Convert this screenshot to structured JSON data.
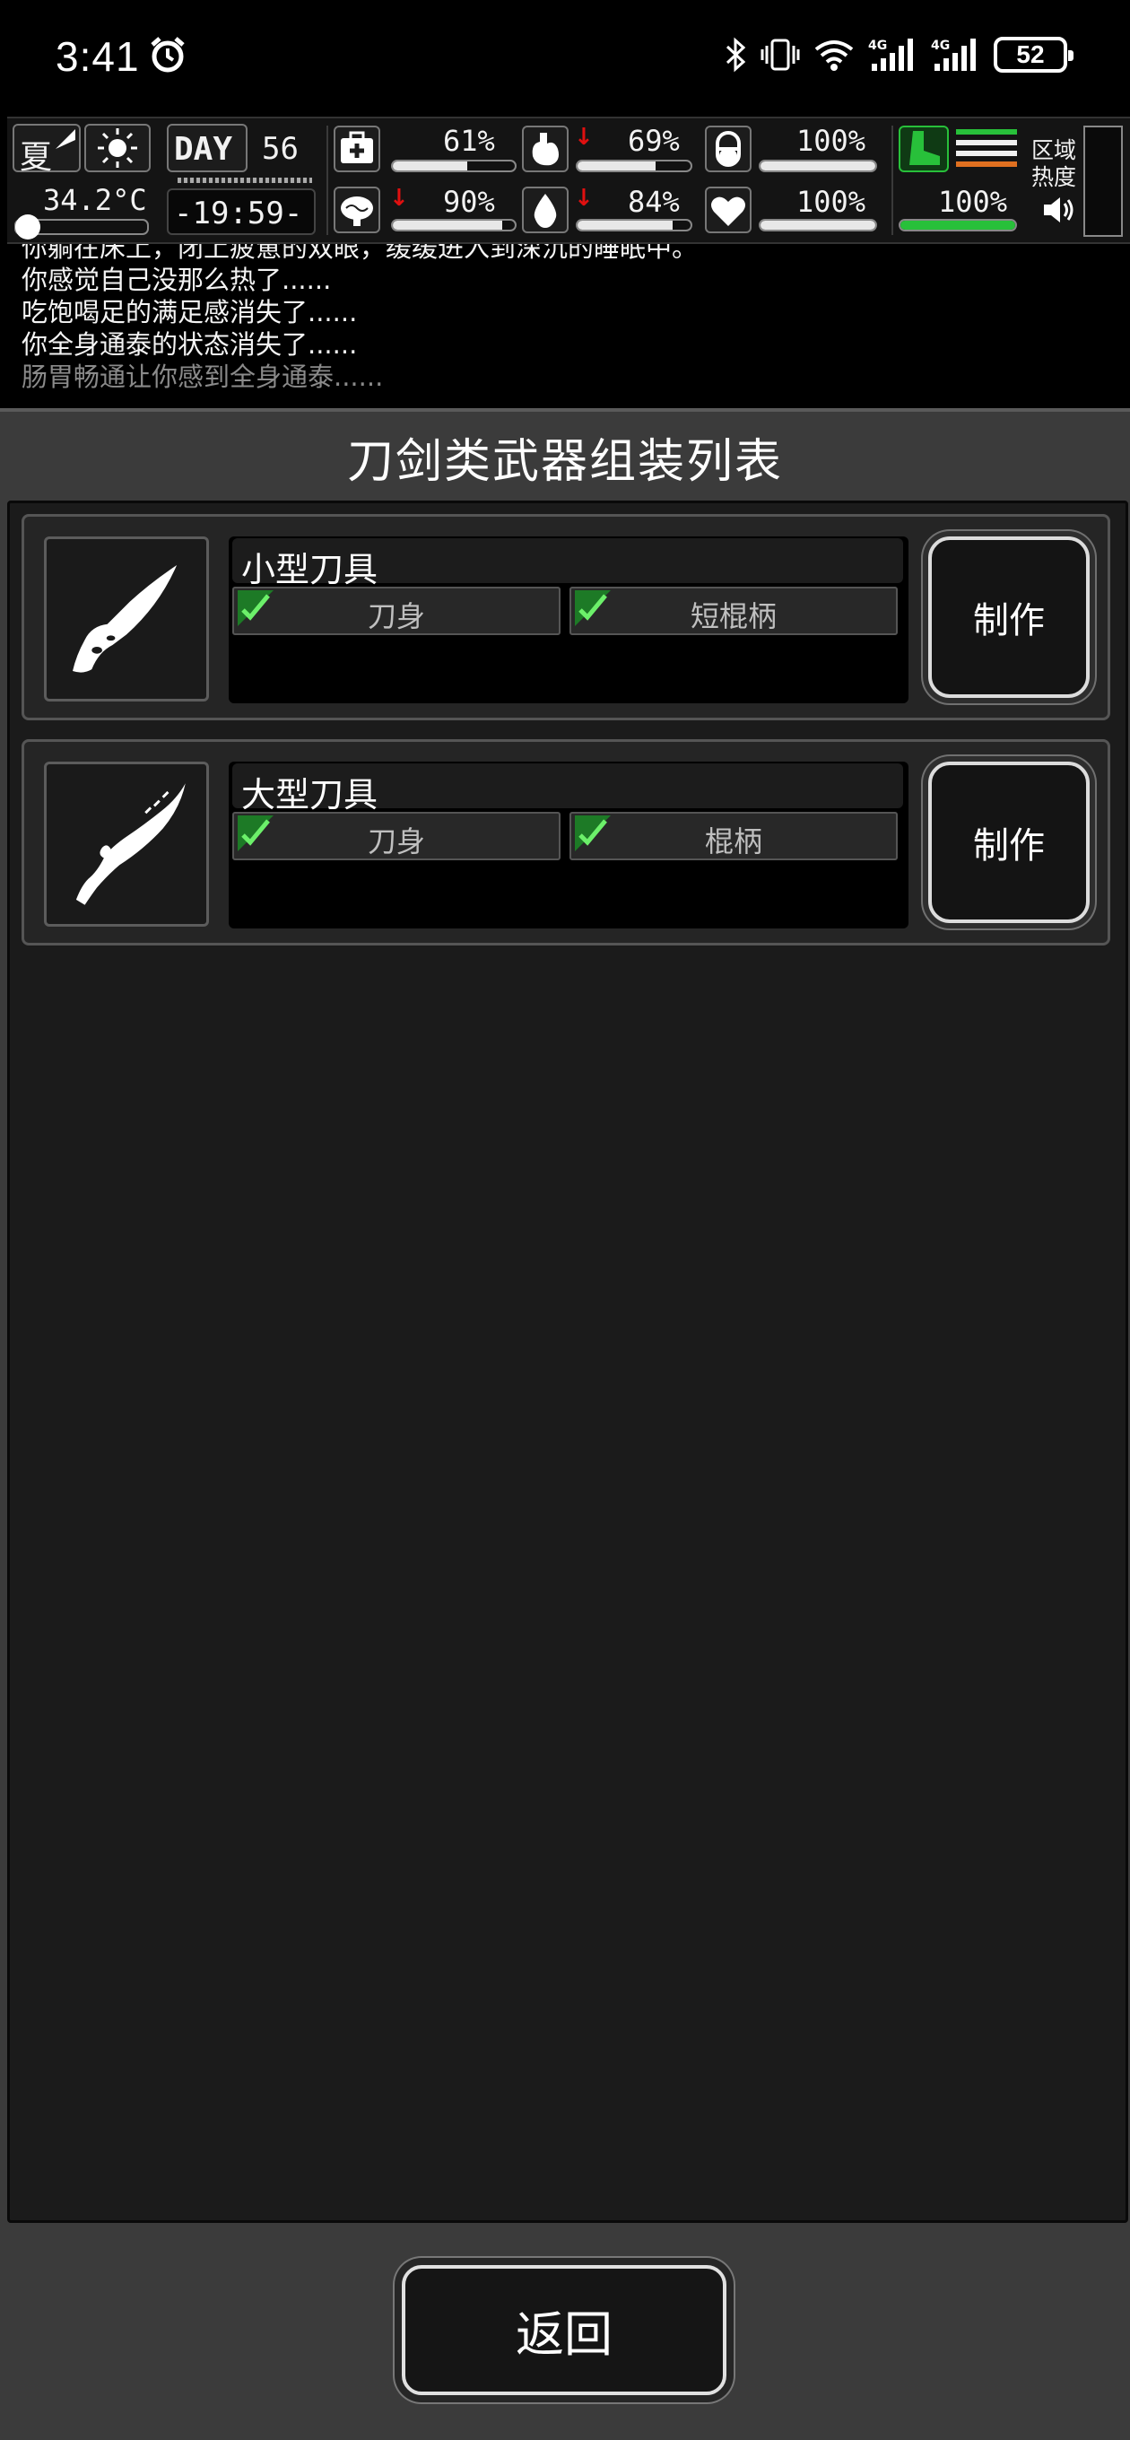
{
  "status_bar": {
    "time": "3:41",
    "battery": "52",
    "icons": [
      "alarm-icon",
      "bluetooth-icon",
      "vibrate-icon",
      "wifi-icon",
      "signal-4g-1-icon",
      "signal-4g-2-icon"
    ]
  },
  "hud": {
    "season": "夏",
    "temperature": "34.2°C",
    "day_label": "DAY",
    "day_number": "56",
    "clock": "-19:59-",
    "stats": {
      "health": {
        "value": "61%",
        "fill": 0.61,
        "icon": "medkit-icon"
      },
      "hunger": {
        "value": "69%",
        "fill": 0.69,
        "icon": "stomach-icon",
        "decreasing": true
      },
      "pill": {
        "value": "100%",
        "fill": 1.0,
        "icon": "pill-icon"
      },
      "mind": {
        "value": "90%",
        "fill": 0.9,
        "icon": "brain-icon",
        "decreasing": true
      },
      "thirst": {
        "value": "84%",
        "fill": 0.84,
        "icon": "water-drop-icon",
        "decreasing": true
      },
      "heart": {
        "value": "100%",
        "fill": 1.0,
        "icon": "heart-icon"
      },
      "stamina": {
        "value": "100%",
        "fill": 1.0,
        "icon": "boot-icon"
      }
    },
    "zone_heat_label_1": "区域",
    "zone_heat_label_2": "热度"
  },
  "log": {
    "lines": [
      "你躺在床上，闭上疲惫的双眼，缓缓进入到深沉的睡眠中。",
      "你感觉自己没那么热了......",
      "吃饱喝足的满足感消失了......",
      "你全身通泰的状态消失了......",
      "肠胃畅通让你感到全身通泰......"
    ]
  },
  "panel": {
    "title": "刀剑类武器组装列表",
    "recipes": [
      {
        "name": "小型刀具",
        "parts": [
          "刀身",
          "短棍柄"
        ],
        "craft_label": "制作",
        "icon": "small-knife-icon"
      },
      {
        "name": "大型刀具",
        "parts": [
          "刀身",
          "棍柄"
        ],
        "craft_label": "制作",
        "icon": "large-knife-icon"
      }
    ],
    "back_label": "返回"
  },
  "colors": {
    "accent_green": "#28c03a",
    "alert_red": "#e01010",
    "panel_bg": "#3b3b3b",
    "list_bg": "#1b1b1b"
  }
}
